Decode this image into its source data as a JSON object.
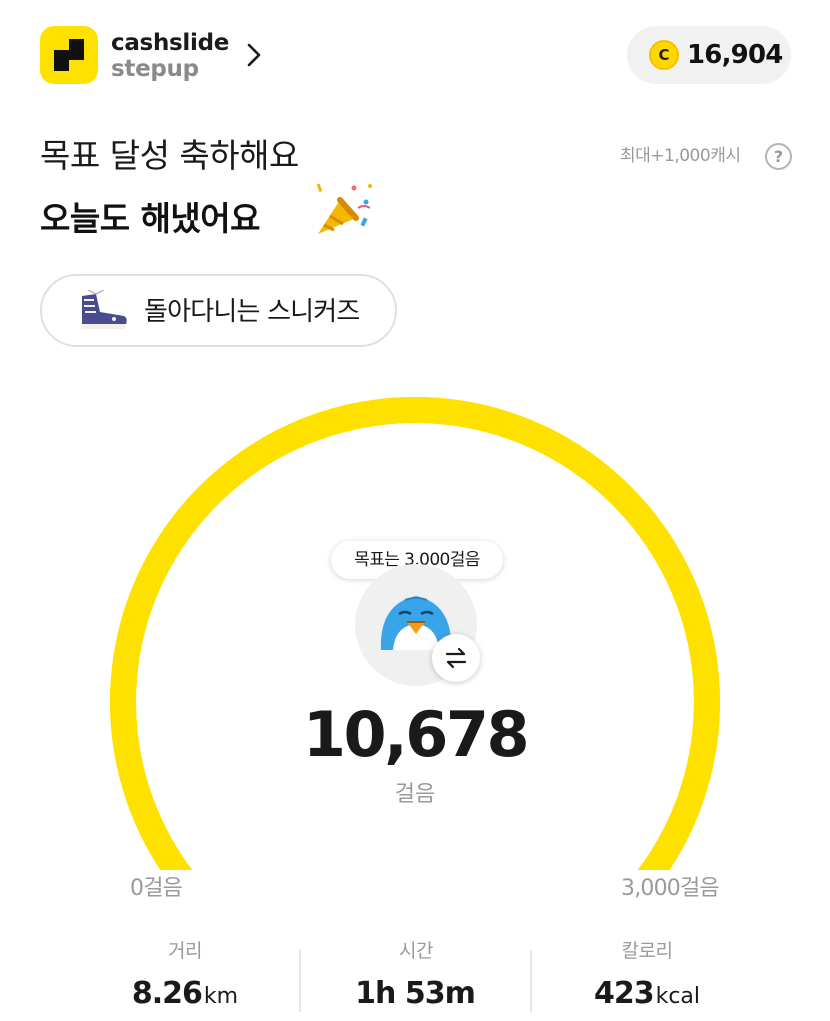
{
  "colors": {
    "accent": "#ffe100",
    "coin": "#ffd600",
    "gauge_track": "#ffe100",
    "muted_text": "#9a9a9a",
    "character_blue": "#3aa4e8"
  },
  "header": {
    "brand_line1": "cashslide",
    "brand_line2": "stepup",
    "brand_chevron_icon": "chevron-right-icon",
    "coin_symbol": "C",
    "points": "16,904"
  },
  "hero": {
    "headline1": "목표 달성 축하해요",
    "headline2": "오늘도 해냈어요",
    "party_icon": "party-popper-icon",
    "max_reward": "최대+1,000캐시",
    "help_symbol": "?"
  },
  "item_chip": {
    "icon": "sneaker-icon",
    "label": "돌아다니는 스니커즈"
  },
  "gauge": {
    "goal_tooltip": "목표는 3,000걸음",
    "character_icon": "penguin-character-icon",
    "swap_icon": "swap-arrows-icon",
    "steps": "10,678",
    "steps_unit": "걸음",
    "range_min": "0걸음",
    "range_max": "3,000걸음",
    "progress_fraction": 1.0
  },
  "stats": [
    {
      "label": "거리",
      "value": "8.26",
      "unit": "km"
    },
    {
      "label": "시간",
      "value": "1h 53m",
      "unit": ""
    },
    {
      "label": "칼로리",
      "value": "423",
      "unit": "kcal"
    }
  ]
}
